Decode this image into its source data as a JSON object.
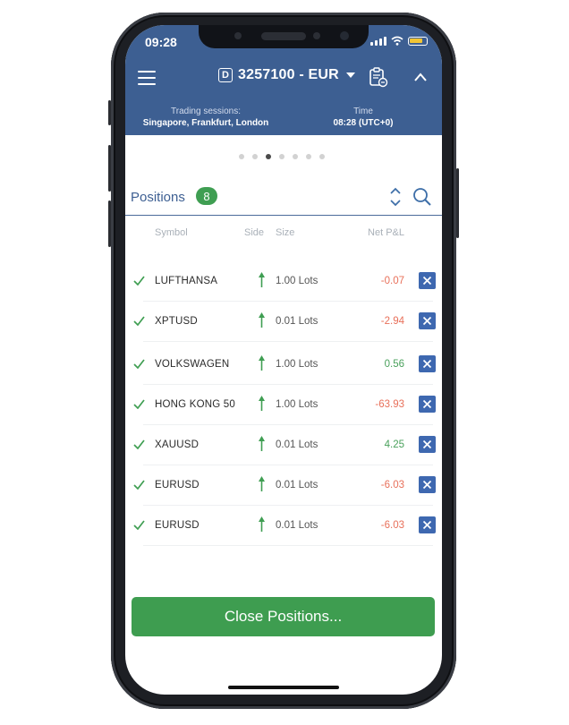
{
  "status_bar": {
    "time": "09:28"
  },
  "header": {
    "account_prefix": "D",
    "account": "3257100 - EUR",
    "trading_sessions_label": "Trading sessions:",
    "trading_sessions_value": "Singapore, Frankfurt, London",
    "time_label": "Time",
    "time_value": "08:28 (UTC+0)"
  },
  "pager": {
    "total": 7,
    "active_index": 2
  },
  "positions": {
    "title": "Positions",
    "count": "8",
    "columns": {
      "symbol": "Symbol",
      "side": "Side",
      "size": "Size",
      "pnl": "Net P&L"
    },
    "rows": [
      {
        "symbol": "LUFTHANSA",
        "size": "1.00 Lots",
        "pnl": "-0.07",
        "pnl_color": "#e8705a"
      },
      {
        "symbol": "XPTUSD",
        "size": "0.01 Lots",
        "pnl": "-2.94",
        "pnl_color": "#e8705a"
      },
      {
        "symbol": "VOLKSWAGEN",
        "size": "1.00 Lots",
        "pnl": "0.56",
        "pnl_color": "#4aa15c"
      },
      {
        "symbol": "HONG KONG 50",
        "size": "1.00 Lots",
        "pnl": "-63.93",
        "pnl_color": "#e8705a"
      },
      {
        "symbol": "XAUUSD",
        "size": "0.01 Lots",
        "pnl": "4.25",
        "pnl_color": "#4aa15c"
      },
      {
        "symbol": "EURUSD",
        "size": "0.01 Lots",
        "pnl": "-6.03",
        "pnl_color": "#e8705a"
      },
      {
        "symbol": "EURUSD",
        "size": "0.01 Lots",
        "pnl": "-6.03",
        "pnl_color": "#e8705a"
      }
    ]
  },
  "close_button": "Close Positions...",
  "colors": {
    "header_bg": "#3d5f92",
    "accent_green": "#3e9d50",
    "close_x_bg": "#3e68b0"
  }
}
